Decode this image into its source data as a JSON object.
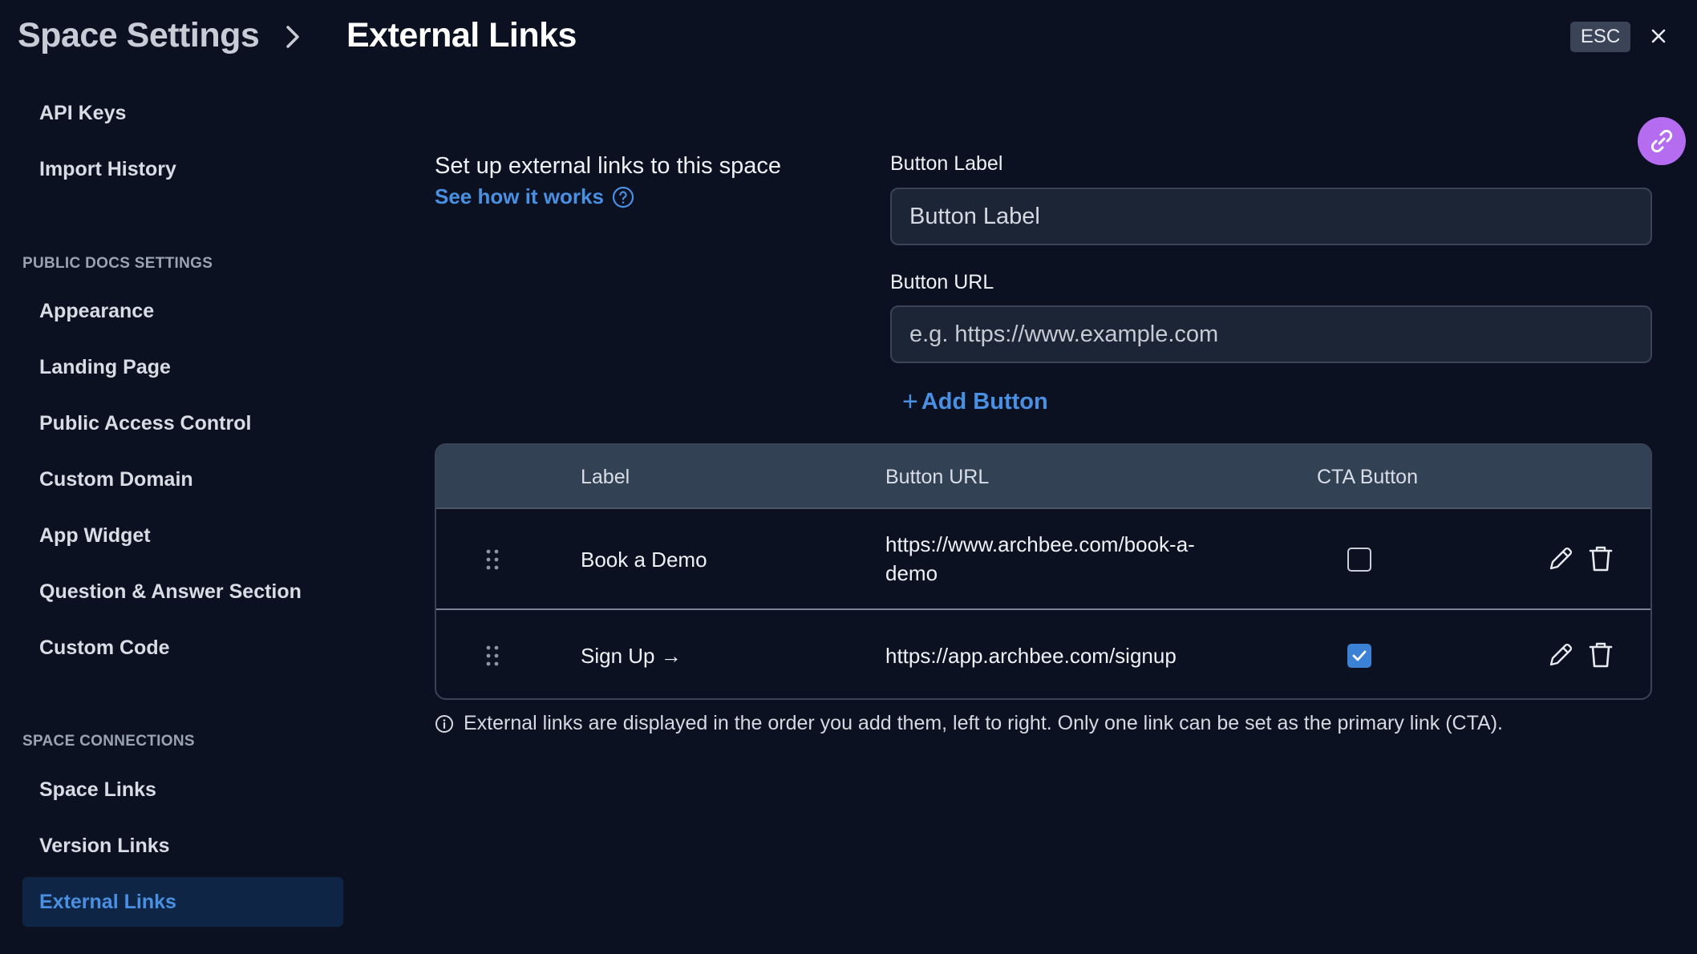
{
  "header": {
    "breadcrumb_root": "Space Settings",
    "breadcrumb_current": "External Links",
    "esc_label": "ESC"
  },
  "sidebar": {
    "items_top": [
      {
        "label": "API Keys"
      },
      {
        "label": "Import History"
      }
    ],
    "section_public": "PUBLIC DOCS SETTINGS",
    "items_public": [
      {
        "label": "Appearance"
      },
      {
        "label": "Landing Page"
      },
      {
        "label": "Public Access Control"
      },
      {
        "label": "Custom Domain"
      },
      {
        "label": "App Widget"
      },
      {
        "label": "Question & Answer Section"
      },
      {
        "label": "Custom Code"
      }
    ],
    "section_connections": "SPACE CONNECTIONS",
    "items_connections": [
      {
        "label": "Space Links"
      },
      {
        "label": "Version Links"
      },
      {
        "label": "External Links",
        "active": true
      }
    ]
  },
  "intro": {
    "title": "Set up external links to this space",
    "link": "See how it works"
  },
  "form": {
    "label_field_label": "Button Label",
    "label_field_value": "Button Label",
    "url_field_label": "Button URL",
    "url_field_placeholder": "e.g. https://www.example.com",
    "add_button": "Add Button"
  },
  "table": {
    "columns": [
      "Label",
      "Button URL",
      "CTA Button"
    ],
    "rows": [
      {
        "label": "Book a Demo",
        "url_line1": "https://www.archbee.com/book-a-",
        "url_line2": "demo",
        "cta": false
      },
      {
        "label": "Sign Up →",
        "url_line1": "https://app.archbee.com/signup",
        "url_line2": "",
        "cta": true
      }
    ]
  },
  "note": "External links are displayed in the order you add them, left to right. Only one link can be set as the primary link (CTA).",
  "colors": {
    "background": "#0b1120",
    "accent": "#4a90e2",
    "fab": "#b56cf0",
    "checkbox_on": "#3b82d6"
  },
  "icons": [
    "chevron-right-icon",
    "close-icon",
    "help-circle-icon",
    "link-icon",
    "plus-icon",
    "grip-icon",
    "check-icon",
    "pencil-icon",
    "trash-icon",
    "info-icon"
  ]
}
